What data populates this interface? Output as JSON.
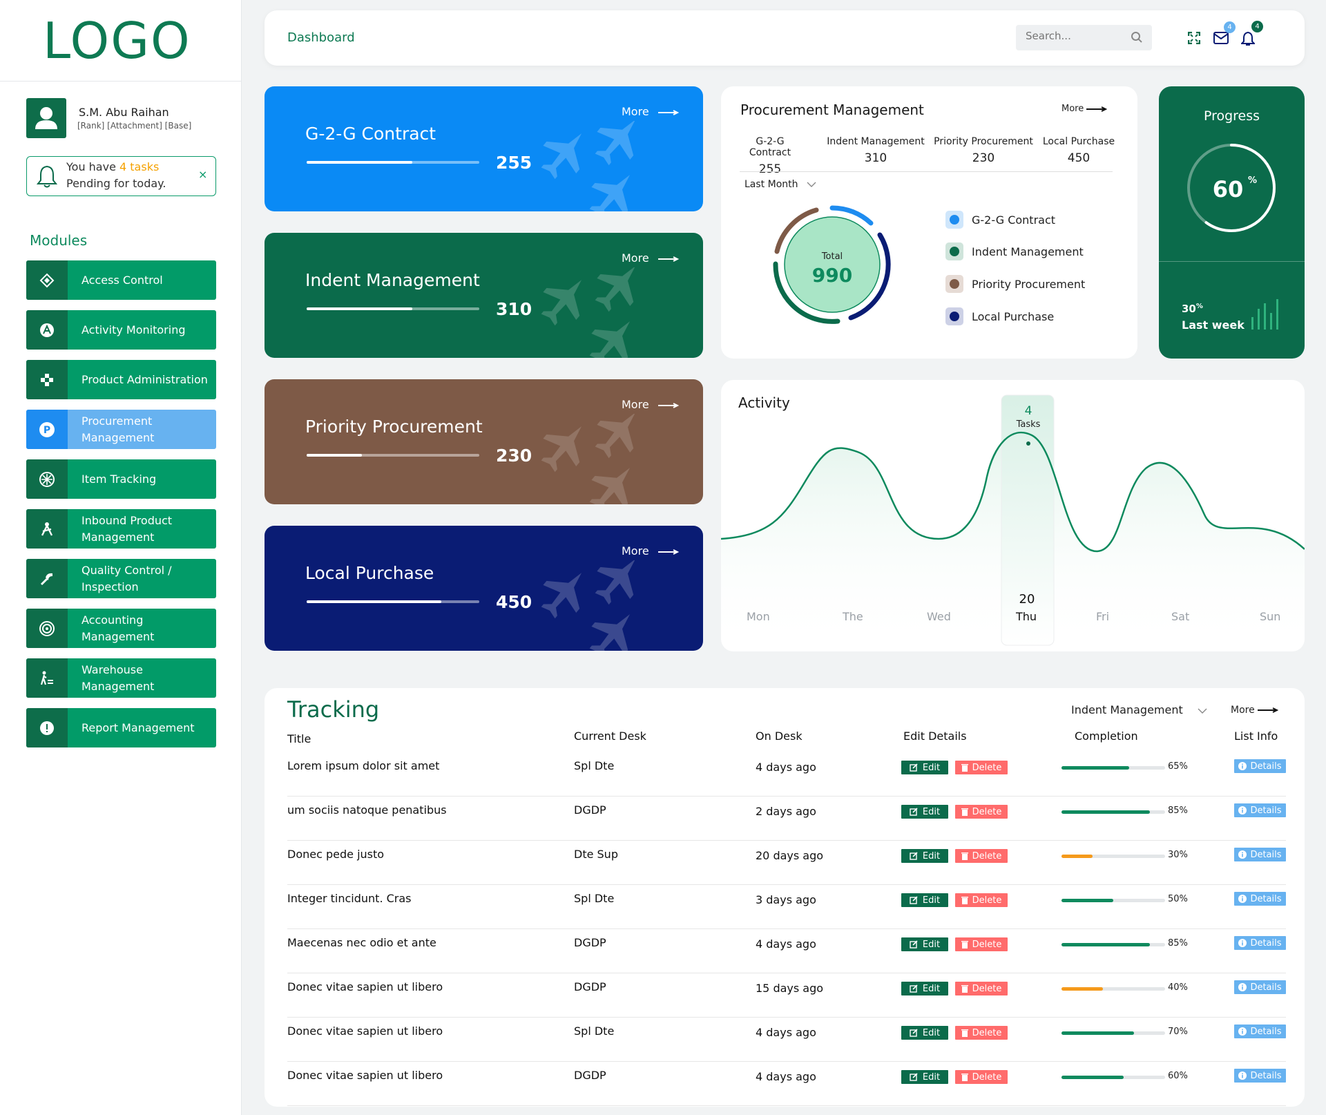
{
  "logo": "LOGO",
  "user": {
    "name": "S.M. Abu Raihan",
    "meta": "[Rank] [Attachment] [Base]"
  },
  "notice": {
    "prefix": "You have",
    "highlight": "4 tasks",
    "line2": "Pending for today.",
    "close": "×"
  },
  "modules": {
    "title": "Modules",
    "items": [
      {
        "l1": "Access Control",
        "l2": ""
      },
      {
        "l1": "Activity Monitoring",
        "l2": ""
      },
      {
        "l1": "Product Administration",
        "l2": ""
      },
      {
        "l1": "Procurement",
        "l2": "Management"
      },
      {
        "l1": "Item Tracking",
        "l2": ""
      },
      {
        "l1": "Inbound Product",
        "l2": "Management"
      },
      {
        "l1": "Quality Control /",
        "l2": "Inspection"
      },
      {
        "l1": "Accounting",
        "l2": "Management"
      },
      {
        "l1": "Warehouse",
        "l2": "Management"
      },
      {
        "l1": "Report Management",
        "l2": ""
      }
    ]
  },
  "header": {
    "title": "Dashboard",
    "search_placeholder": "Search...",
    "mail_count": "4",
    "notif_count": "4"
  },
  "cards": [
    {
      "title": "G-2-G Contract",
      "value": "255",
      "more": "More",
      "progress": 0.61,
      "color": "#0a8af5"
    },
    {
      "title": "Indent Management",
      "value": "310",
      "more": "More",
      "progress": 0.61,
      "color": "#0b6b4b"
    },
    {
      "title": "Priority Procurement",
      "value": "230",
      "more": "More",
      "progress": 0.32,
      "color": "#7e5a47"
    },
    {
      "title": "Local Purchase",
      "value": "450",
      "more": "More",
      "progress": 0.78,
      "color": "#0a1c74"
    }
  ],
  "procurement": {
    "title": "Procurement Management",
    "more": "More",
    "columns": [
      {
        "label": "G-2-G Contract",
        "value": "255"
      },
      {
        "label": "Indent Management",
        "value": "310"
      },
      {
        "label": "Priority Procurement",
        "value": "230"
      },
      {
        "label": "Local Purchase",
        "value": "450"
      }
    ],
    "period": "Last Month",
    "total_label": "Total",
    "total_value": "990",
    "legend": [
      {
        "label": "G-2-G Contract",
        "color": "#1e8cf0"
      },
      {
        "label": "Indent Management",
        "color": "#0b6b4b"
      },
      {
        "label": "Priority Procurement",
        "color": "#7e5a47"
      },
      {
        "label": "Local Purchase",
        "color": "#0a1c74"
      }
    ]
  },
  "progress": {
    "title": "Progress",
    "value": "60",
    "unit": "%",
    "fraction": 0.6,
    "lw_value": "30",
    "lw_unit": "%",
    "lw_label": "Last week"
  },
  "activity": {
    "title": "Activity",
    "tooltip_value": "4",
    "tooltip_label": "Tasks",
    "selected_date": "20",
    "days": [
      "Mon",
      "The",
      "Wed",
      "Thu",
      "Fri",
      "Sat",
      "Sun"
    ]
  },
  "tracking": {
    "title": "Tracking",
    "filter": "Indent Management",
    "more": "More",
    "headers": [
      "Title",
      "Current Desk",
      "On Desk",
      "Edit Details",
      "Completion",
      "List Info"
    ],
    "edit_label": "Edit",
    "delete_label": "Delete",
    "details_label": "Details",
    "rows": [
      {
        "title": "Lorem ipsum dolor sit amet",
        "desk": "Spl Dte",
        "on": "4 days ago",
        "pct": 65,
        "pct_text": "65%",
        "color": "#0e8a5e"
      },
      {
        "title": "um sociis natoque penatibus",
        "desk": "DGDP",
        "on": "2 days ago",
        "pct": 85,
        "pct_text": "85%",
        "color": "#0e8a5e"
      },
      {
        "title": "Donec pede justo",
        "desk": "Dte Sup",
        "on": "20 days ago",
        "pct": 30,
        "pct_text": "30%",
        "color": "#f59a1b"
      },
      {
        "title": "Integer tincidunt. Cras",
        "desk": "Spl Dte",
        "on": "3 days ago",
        "pct": 50,
        "pct_text": "50%",
        "color": "#0e8a5e"
      },
      {
        "title": "Maecenas nec odio et ante",
        "desk": "DGDP",
        "on": "4 days ago",
        "pct": 85,
        "pct_text": "85%",
        "color": "#0e8a5e"
      },
      {
        "title": "Donec vitae sapien ut libero",
        "desk": "DGDP",
        "on": "15 days ago",
        "pct": 40,
        "pct_text": "40%",
        "color": "#f59a1b"
      },
      {
        "title": "Donec vitae sapien ut libero",
        "desk": "Spl Dte",
        "on": "4 days ago",
        "pct": 70,
        "pct_text": "70%",
        "color": "#0e8a5e"
      },
      {
        "title": "Donec vitae sapien ut libero",
        "desk": "DGDP",
        "on": "4 days ago",
        "pct": 60,
        "pct_text": "60%",
        "color": "#0e8a5e"
      }
    ]
  }
}
